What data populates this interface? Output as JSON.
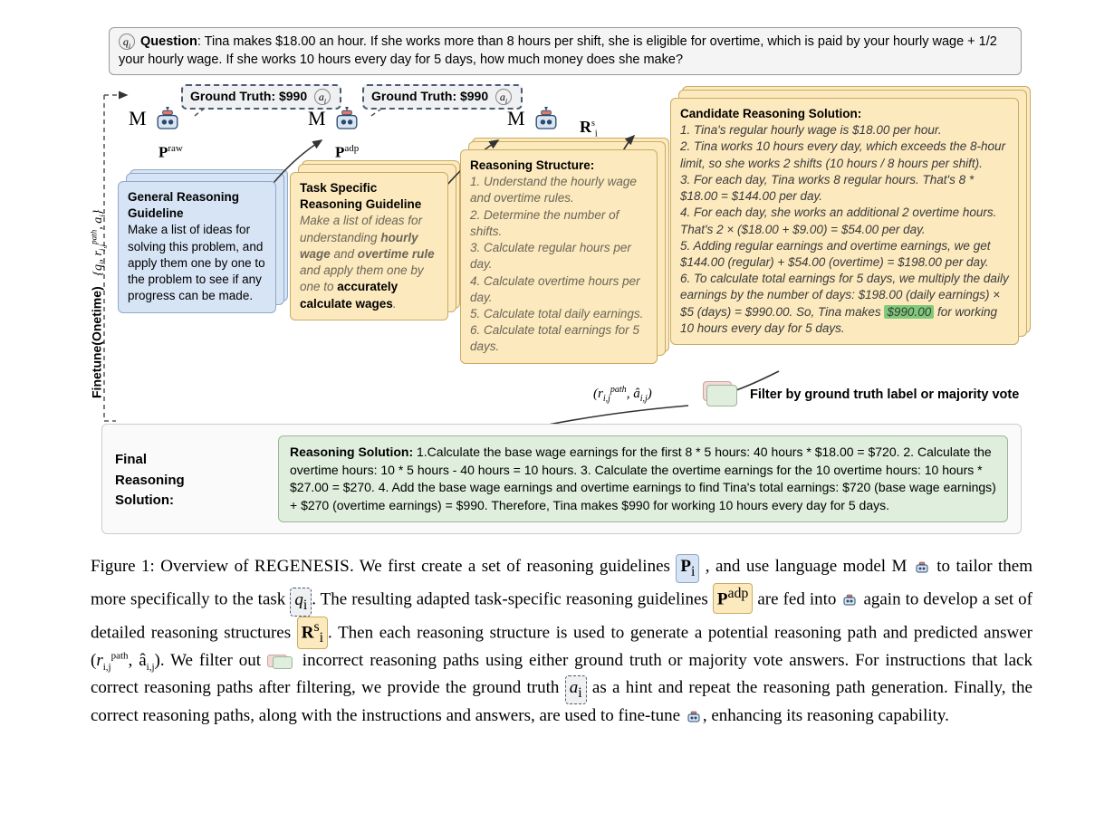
{
  "question": {
    "label": "Question",
    "text": ": Tina makes $18.00 an hour. If she works more than 8 hours per shift, she is eligible for overtime, which is paid by your hourly wage + 1/2 your hourly wage.  If she works 10 hours every day for 5 days, how much money does she make?"
  },
  "ground_truth": {
    "label": "Ground Truth",
    "value": ": $990",
    "icon": "a",
    "sub": "i"
  },
  "model_label": "M",
  "p_raw": "raw",
  "p_adp": "adp",
  "rs_label": "R",
  "guideline_general": {
    "title": "General Reasoning Guideline",
    "body": "Make a list of ideas for solving this problem, and apply them one by one to the problem to see if any progress can be made."
  },
  "guideline_task": {
    "title": "Task Specific Reasoning Guideline",
    "body_pre": "Make a list of ideas for understanding ",
    "body_bold1": "hourly wage",
    "body_mid": " and ",
    "body_bold2": "overtime rule",
    "body_post": " and apply them one by one to ",
    "body_bold3": "accurately calculate wages",
    "body_end": "."
  },
  "reasoning_structure": {
    "title": "Reasoning Structure",
    "items": [
      "1. Understand the hourly wage and overtime rules.",
      "2. Determine the number of shifts.",
      "3. Calculate regular hours per day.",
      "4. Calculate overtime hours per day.",
      "5. Calculate total daily earnings.",
      "6. Calculate total earnings for 5 days."
    ]
  },
  "candidate": {
    "title": "Candidate Reasoning Solution:",
    "lines": [
      "1. Tina's regular hourly wage is $18.00 per hour.",
      "2. Tina works 10 hours every day, which exceeds the 8-hour limit, so she works 2 shifts (10 hours / 8 hours per shift).",
      "3. For each day, Tina works 8 regular hours. That's 8 * $18.00 = $144.00 per day.",
      "4. For each day, she works an additional 2 overtime hours. That's 2 × ($18.00 + $9.00) = $54.00 per day.",
      "5. Adding regular earnings and overtime earnings, we get $144.00 (regular) + $54.00 (overtime) = $198.00 per day.",
      "6. To calculate total earnings for 5 days, we multiply the daily earnings by the number of days: $198.00 (daily earnings) × $5 (days) = $990.00. So, Tina makes"
    ],
    "highlight": "$990.00",
    "tail": " for working 10 hours every day for 5 days."
  },
  "tuple": "(r",
  "tuple_sup": "path",
  "tuple_sub": "i,j",
  "tuple_mid": ", â",
  "tuple_sub2": "i,j",
  "tuple_end": ")",
  "filter_label": "Filter by ground truth label or majority vote",
  "final": {
    "title1": "Final",
    "title2": "Reasoning",
    "title3": "Solution",
    "colon": ":",
    "leading": "Reasoning Solution: ",
    "body": "1.Calculate the base wage earnings for the first 8 * 5 hours: 40 hours * $18.00 = $720. 2. Calculate the overtime hours: 10 * 5 hours - 40 hours = 10 hours. 3. Calculate the overtime earnings for the 10 overtime hours: 10 hours * $27.00 = $270. 4. Add the base wage earnings and overtime earnings to find Tina's total earnings: $720 (base wage earnings) + $270 (overtime earnings) = $990. Therefore, Tina makes $990 for working 10 hours every day for 5 days."
  },
  "sidebar": {
    "finetune": "Finetune(Onetime)",
    "set": "{q",
    "set_i": "i",
    "set_mid": ", r",
    "set_sup": "path",
    "set_sub": "i,j",
    "set_mid2": ", a",
    "set_i2": "i",
    "set_end": "}"
  },
  "caption": {
    "fig": "Figure 1: Overview of ",
    "name": "ReGenesis",
    "s1a": ". We first create a set of reasoning guidelines ",
    "pi": "P",
    "pi_sub": "i",
    "s1b": " , and use language model M ",
    "s1c": " to tailor them more specifically to the task ",
    "qi": "q",
    "qi_sub": "i",
    "s1d": ".  The resulting adapted task-specific reasoning guidelines ",
    "padp": "P",
    "padp_sup": "adp",
    "s2a": " are fed into ",
    "s2b": " again to develop a set of detailed reasoning structures ",
    "rs": "R",
    "rs_sup": "s",
    "rs_sub": "i",
    "s2c": ". Then each reasoning structure is used to generate a potential reasoning path and predicted answer ",
    "tuple_open": "(r",
    "tuple_sup": "path",
    "tuple_sub": "i,j",
    "tuple_mid": ", â",
    "tuple_sub2": "i,j",
    "tuple_close": ")",
    "s3a": ". We filter out ",
    "s3b": " incorrect reasoning paths using either ground truth or majority vote answers. For instructions that lack correct reasoning paths after filtering, we provide the ground truth ",
    "ai": "a",
    "ai_sub": "i",
    "s4a": " as a hint and repeat the reasoning path generation. Finally, the correct reasoning paths, along with the instructions and answers, are used to fine-tune ",
    "s4b": ", enhancing its reasoning capability."
  }
}
